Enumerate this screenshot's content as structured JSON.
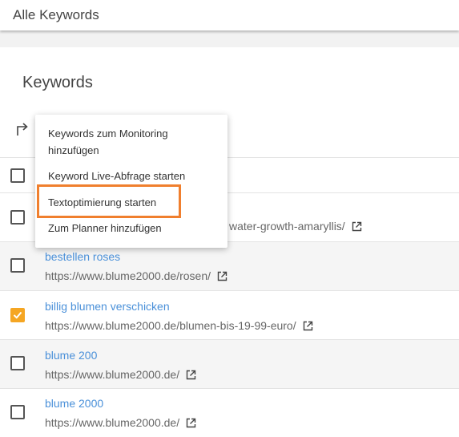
{
  "header": {
    "title": "Alle Keywords"
  },
  "card": {
    "title": "Keywords"
  },
  "menu": {
    "items": [
      "Keywords zum Monitoring hinzufügen",
      "Keyword Live-Abfrage starten",
      "Textoptimierung starten",
      "Zum Planner hinzufügen"
    ],
    "highlighted": "Textoptimierung starten"
  },
  "rows": [
    {
      "keyword": "",
      "url": "water-growth-amaryllis/",
      "checked": false
    },
    {
      "keyword": "bestellen roses",
      "url": "https://www.blume2000.de/rosen/",
      "checked": false
    },
    {
      "keyword": "billig blumen verschicken",
      "url": "https://www.blume2000.de/blumen-bis-19-99-euro/",
      "checked": true
    },
    {
      "keyword": "blume 200",
      "url": "https://www.blume2000.de/",
      "checked": false
    },
    {
      "keyword": "blume 2000",
      "url": "https://www.blume2000.de/",
      "checked": false
    }
  ],
  "colors": {
    "accent": "#f5a623",
    "link": "#4a90d9",
    "highlight": "#f07f2e"
  }
}
